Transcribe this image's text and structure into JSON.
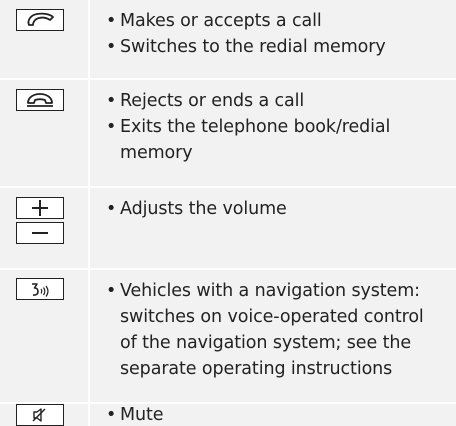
{
  "rows": [
    {
      "keys": [
        {
          "icon": "phone-call-icon"
        }
      ],
      "items": [
        "Makes or accepts a call",
        "Switches to the redial memory"
      ]
    },
    {
      "keys": [
        {
          "icon": "phone-hangup-icon"
        }
      ],
      "items": [
        "Rejects or ends a call",
        "Exits the telephone book/redial memory"
      ]
    },
    {
      "keys": [
        {
          "icon": "volume-plus-icon",
          "glyph": "+"
        },
        {
          "icon": "volume-minus-icon",
          "glyph": "−"
        }
      ],
      "items": [
        "Adjusts the volume"
      ]
    },
    {
      "keys": [
        {
          "icon": "voice-control-icon"
        }
      ],
      "items": [
        "Vehicles with a navigation system: switches on voice-operated control of the navigation system; see the separate operating instructions"
      ]
    },
    {
      "keys": [
        {
          "icon": "mute-icon"
        }
      ],
      "items": [
        "Mute"
      ]
    }
  ]
}
